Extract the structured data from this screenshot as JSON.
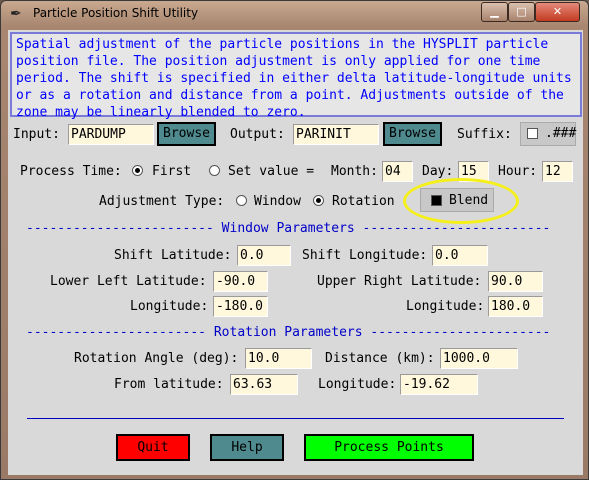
{
  "window": {
    "title": "Particle Position Shift Utility",
    "app_icon": "feather-icon",
    "minimize": "▁",
    "maximize": "□",
    "close": "✕"
  },
  "description": "Spatial adjustment of the particle positions in the HYSPLIT particle\nposition file. The position adjustment is only applied for one time\nperiod. The shift is specified in either delta latitude-longitude units\nor as a rotation and distance from a point. Adjustments outside of the\nzone may be linearly blended to zero.",
  "files": {
    "input_label": "Input:",
    "input_value": "PARDUMP",
    "browse_label": "Browse",
    "output_label": "Output:",
    "output_value": "PARINIT",
    "suffix_label": "Suffix:",
    "suffix_value": ".###"
  },
  "process_time": {
    "label": "Process Time:",
    "first_label": "First",
    "set_label": "Set value =",
    "month_label": "Month:",
    "month_value": "04",
    "day_label": "Day:",
    "day_value": "15",
    "hour_label": "Hour:",
    "hour_value": "12",
    "selected": "First"
  },
  "adjustment": {
    "label": "Adjustment Type:",
    "window_label": "Window",
    "rotation_label": "Rotation",
    "blend_label": "Blend",
    "selected": "Rotation",
    "blend_checked": true
  },
  "window_params": {
    "header": "------------------------ Window Parameters ------------------------",
    "shift_lat_label": "Shift Latitude:",
    "shift_lat_value": "0.0",
    "shift_lon_label": "Shift Longitude:",
    "shift_lon_value": "0.0",
    "ll_lat_label": "Lower Left Latitude:",
    "ll_lat_value": "-90.0",
    "ur_lat_label": "Upper Right Latitude:",
    "ur_lat_value": "90.0",
    "ll_lon_label": "Longitude:",
    "ll_lon_value": "-180.0",
    "ur_lon_label": "Longitude:",
    "ur_lon_value": "180.0"
  },
  "rotation_params": {
    "header": "----------------------- Rotation Parameters -----------------------",
    "angle_label": "Rotation Angle (deg):",
    "angle_value": "10.0",
    "distance_label": "Distance (km):",
    "distance_value": "1000.0",
    "from_lat_label": "From latitude:",
    "from_lat_value": "63.63",
    "lon_label": "Longitude:",
    "lon_value": "-19.62"
  },
  "buttons": {
    "quit": "Quit",
    "help": "Help",
    "process": "Process Points"
  },
  "colors": {
    "quit": "#ff0000",
    "help": "#4f8a8e",
    "process": "#00ff00",
    "header_text": "#0000c8",
    "entry_bg": "#fff8dc",
    "highlight": "#f5ef1a"
  }
}
